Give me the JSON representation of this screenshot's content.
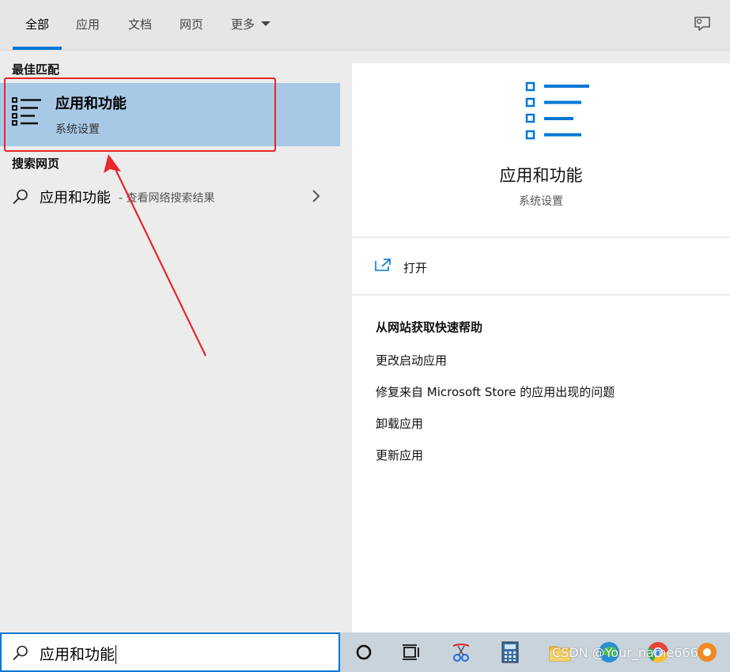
{
  "tabs": [
    {
      "label": "全部",
      "active": true
    },
    {
      "label": "应用",
      "active": false
    },
    {
      "label": "文档",
      "active": false
    },
    {
      "label": "网页",
      "active": false
    },
    {
      "label": "更多",
      "active": false
    }
  ],
  "left": {
    "best_match_heading": "最佳匹配",
    "best_match": {
      "title": "应用和功能",
      "subtitle": "系统设置",
      "icon": "apps-list-icon"
    },
    "web_heading": "搜索网页",
    "web_result": {
      "title": "应用和功能",
      "suffix": "- 查看网络搜索结果",
      "icon": "search-icon"
    }
  },
  "right": {
    "title": "应用和功能",
    "subtitle": "系统设置",
    "open_label": "打开",
    "help_heading": "从网站获取快速帮助",
    "help_links": [
      "更改启动应用",
      "修复来自 Microsoft Store 的应用出现的问题",
      "卸载应用",
      "更新应用"
    ]
  },
  "search": {
    "value": "应用和功能"
  },
  "taskbar": {
    "icons": [
      "cortana-icon",
      "task-view-icon",
      "snipping-tool-icon",
      "calculator-icon",
      "file-explorer-icon",
      "edge-icon",
      "chrome-icon",
      "app-icon"
    ],
    "watermark": "CSDN @Your_name666"
  },
  "colors": {
    "accent": "#0078d7",
    "selection": "#a8c9e6",
    "annotation": "#e8252a"
  }
}
